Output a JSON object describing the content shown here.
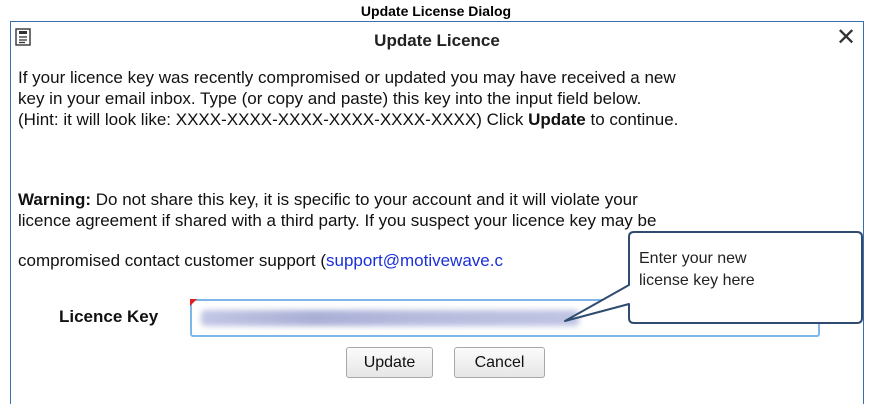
{
  "caption": "Update License Dialog",
  "dialog": {
    "title": "Update Licence",
    "close_symbol": "✕",
    "instruction": {
      "line1": "If your licence key was recently compromised or updated you may have received a new",
      "line2": "key in your email inbox.  Type (or copy and paste) this key into the input field below.",
      "line3_pre": "(Hint: it will look like: XXXX-XXXX-XXXX-XXXX-XXXX-XXXX) Click ",
      "line3_bold": "Update",
      "line3_post": " to continue."
    },
    "warning": {
      "label": "Warning:",
      "line1_rest": " Do not share this key, it is specific to your account and it will violate your",
      "line2": "licence agreement if shared with a third party. If you suspect your licence key may be",
      "line3_pre": "compromised contact customer support (",
      "email": "support@motivewave.c"
    },
    "licence_key": {
      "label": "Licence Key",
      "value_obscured": true
    },
    "buttons": {
      "update": "Update",
      "cancel": "Cancel"
    }
  },
  "callout": {
    "line1": "Enter your new",
    "line2": "license key here"
  },
  "icons": {
    "title": "document-icon",
    "close": "close-icon"
  },
  "colors": {
    "dialog_border": "#3a6fb0",
    "link": "#1a2fd8",
    "input_focus_border": "#7fb6ea",
    "required_marker": "#e02020",
    "callout_border": "#2f4b70"
  }
}
